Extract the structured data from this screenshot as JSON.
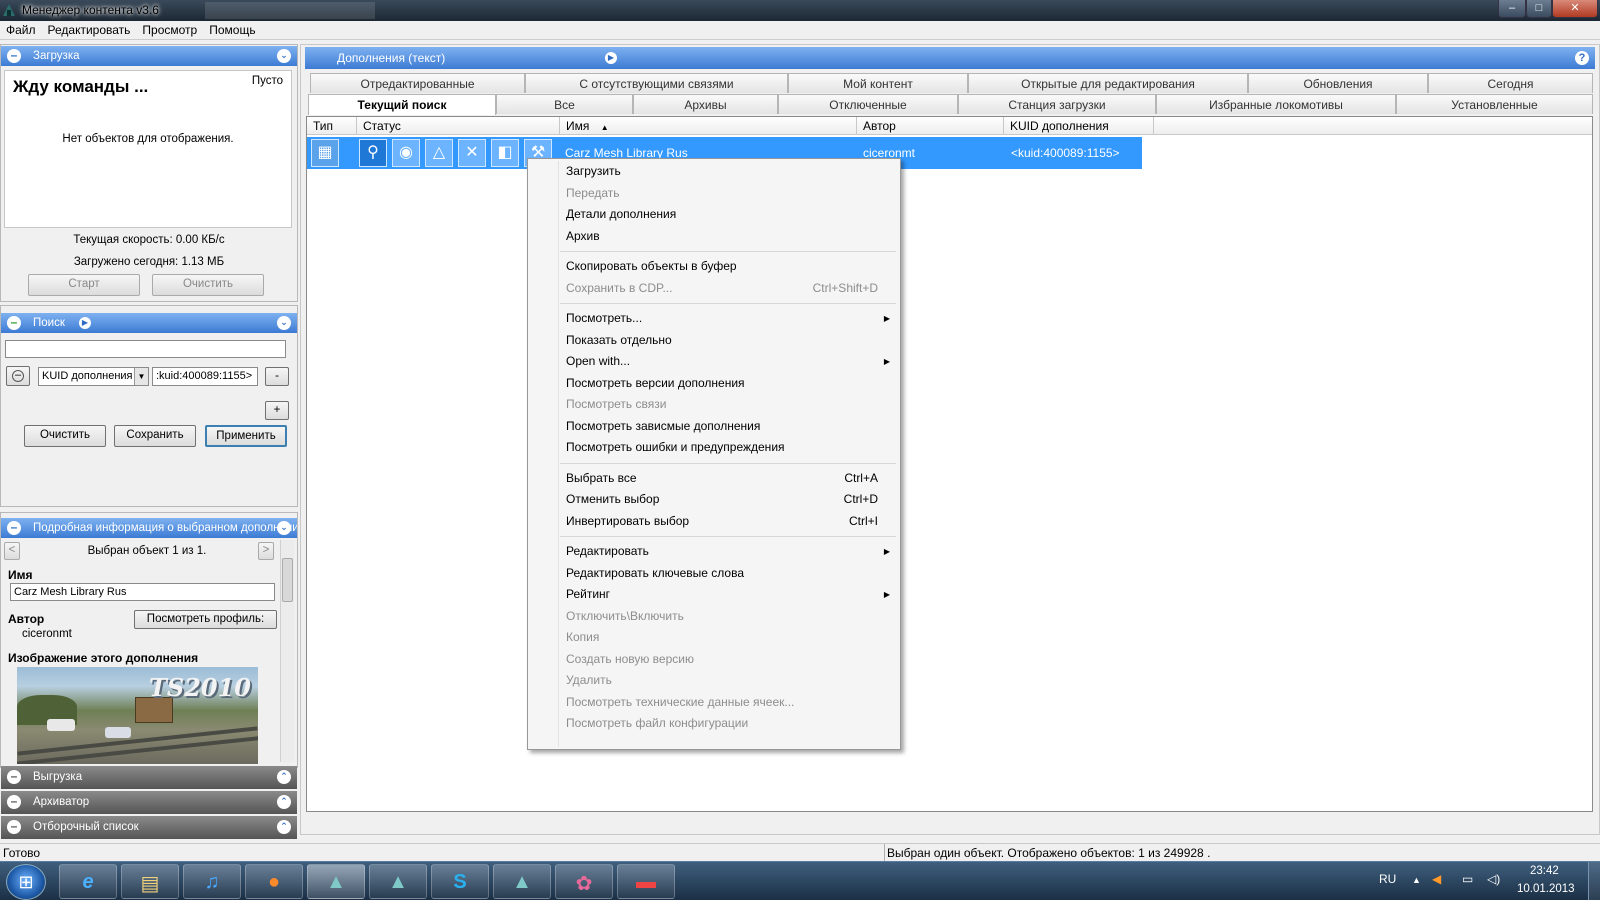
{
  "window": {
    "title": "Менеджер контента v3.6",
    "controls": [
      "–",
      "□",
      "✕"
    ]
  },
  "menu": [
    "Файл",
    "Редактировать",
    "Просмотр",
    "Помощь"
  ],
  "download_panel": {
    "header": "Загрузка",
    "heading": "Жду команды ...",
    "empty_tag": "Пусто",
    "empty_message": "Нет объектов для отображения.",
    "speed": "Текущая скорость: 0.00 КБ/с",
    "today": "Загружено сегодня: 1.13 МБ",
    "start": "Старт",
    "clear": "Очистить"
  },
  "search_panel": {
    "header": "Поиск",
    "query": "",
    "field": "KUID дополнения",
    "value": ":kuid:400089:1155>",
    "minus": "-",
    "plus": "+",
    "clear": "Очистить",
    "save": "Сохранить",
    "apply": "Применить"
  },
  "details_panel": {
    "header": "Подробная информация о выбранном дополнении",
    "nav_prev": "<",
    "nav_next": ">",
    "selected": "Выбран объект  1  из 1.",
    "name_label": "Имя",
    "name_value": "Carz Mesh Library Rus",
    "author_label": "Автор",
    "author_value": "ciceronmt",
    "profile_button": "Посмотреть профиль:",
    "image_label": "Изображение этого дополнения",
    "image_text": "TS2010"
  },
  "collapsed_panels": [
    "Выгрузка",
    "Архиватор",
    "Отборочный список"
  ],
  "right_header": "Дополнения (текст)",
  "help": "?",
  "tabs_row1": [
    "Отредактированные",
    "С отсутствующими связями",
    "Мой контент",
    "Открытые для редактирования",
    "Обновления",
    "Сегодня"
  ],
  "tabs_row2": [
    "Текущий поиск",
    "Все",
    "Архивы",
    "Отключенные",
    "Станция загрузки",
    "Избранные локомотивы",
    "Установленные"
  ],
  "active_tab": "Текущий поиск",
  "columns": [
    "Тип",
    "Статус",
    "Имя",
    "Автор",
    "KUID дополнения"
  ],
  "sort_indicator": "▲",
  "row": {
    "name": "Carz Mesh Library Rus",
    "author": "ciceronmt",
    "kuid": "<kuid:400089:1155>"
  },
  "context_menu": [
    {
      "label": "Загрузить",
      "shortcut": "",
      "disabled": false,
      "submenu": false
    },
    {
      "label": "Передать",
      "shortcut": "",
      "disabled": true,
      "submenu": false
    },
    {
      "label": "Детали дополнения",
      "shortcut": "",
      "disabled": false,
      "submenu": false
    },
    {
      "label": "Архив",
      "shortcut": "",
      "disabled": false,
      "submenu": false
    },
    {
      "separator": true
    },
    {
      "label": "Скопировать объекты в буфер",
      "shortcut": "",
      "disabled": false,
      "submenu": false
    },
    {
      "label": "Сохранить в CDP...",
      "shortcut": "Ctrl+Shift+D",
      "disabled": true,
      "submenu": false
    },
    {
      "separator": true
    },
    {
      "label": "Посмотреть...",
      "shortcut": "",
      "disabled": false,
      "submenu": true
    },
    {
      "label": "Показать отдельно",
      "shortcut": "",
      "disabled": false,
      "submenu": false
    },
    {
      "label": "Open with...",
      "shortcut": "",
      "disabled": false,
      "submenu": true
    },
    {
      "label": "Посмотреть версии дополнения",
      "shortcut": "",
      "disabled": false,
      "submenu": false
    },
    {
      "label": "Посмотреть связи",
      "shortcut": "",
      "disabled": true,
      "submenu": false
    },
    {
      "label": "Посмотреть зависмые дополнения",
      "shortcut": "",
      "disabled": false,
      "submenu": false
    },
    {
      "label": "Посмотреть ошибки и предупреждения",
      "shortcut": "",
      "disabled": false,
      "submenu": false
    },
    {
      "separator": true
    },
    {
      "label": "Выбрать все",
      "shortcut": "Ctrl+A",
      "disabled": false,
      "submenu": false
    },
    {
      "label": "Отменить выбор",
      "shortcut": "Ctrl+D",
      "disabled": false,
      "submenu": false
    },
    {
      "label": "Инвертировать выбор",
      "shortcut": "Ctrl+I",
      "disabled": false,
      "submenu": false
    },
    {
      "separator": true
    },
    {
      "label": "Редактировать",
      "shortcut": "",
      "disabled": false,
      "submenu": true
    },
    {
      "label": "Редактировать ключевые слова",
      "shortcut": "",
      "disabled": false,
      "submenu": false
    },
    {
      "label": "Рейтинг",
      "shortcut": "",
      "disabled": false,
      "submenu": true
    },
    {
      "label": "Отключить\\Включить",
      "shortcut": "",
      "disabled": true,
      "submenu": false
    },
    {
      "label": "Копия",
      "shortcut": "",
      "disabled": true,
      "submenu": false
    },
    {
      "label": "Создать новую версию",
      "shortcut": "",
      "disabled": true,
      "submenu": false
    },
    {
      "label": "Удалить",
      "shortcut": "",
      "disabled": true,
      "submenu": false
    },
    {
      "label": "Посмотреть технические данные ячеек...",
      "shortcut": "",
      "disabled": true,
      "submenu": false
    },
    {
      "label": "Посмотреть файл конфигурации",
      "shortcut": "",
      "disabled": true,
      "submenu": false
    }
  ],
  "status": {
    "left": "Готово",
    "right": "Выбран один объект. Отображено объектов: 1 из 249928 ."
  },
  "taskbar": {
    "lang": "RU",
    "time": "23:42",
    "date": "10.01.2013"
  }
}
